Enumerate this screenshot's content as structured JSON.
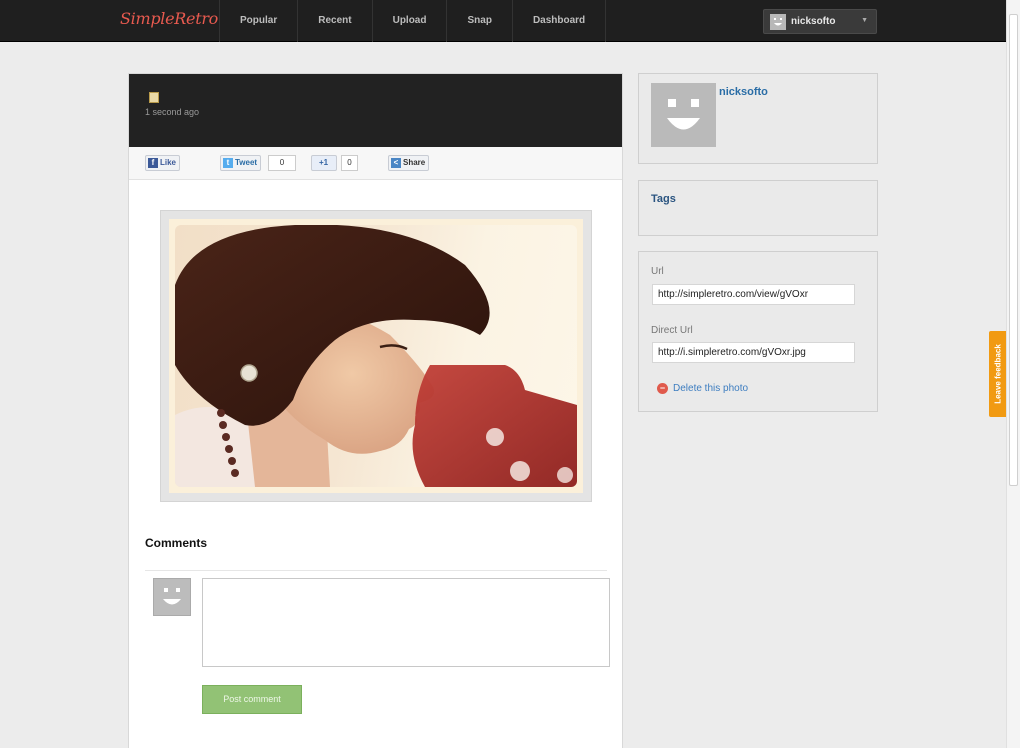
{
  "header": {
    "logo": "SimpleRetro",
    "nav": [
      "Popular",
      "Recent",
      "Upload",
      "Snap",
      "Dashboard"
    ],
    "user": "nicksofto"
  },
  "photo": {
    "timestamp": "1 second ago"
  },
  "share": {
    "like_label": "Like",
    "tweet_label": "Tweet",
    "tweet_count": "0",
    "plusone_label": "+1",
    "plusone_count": "0",
    "share_label": "Share"
  },
  "comments": {
    "title": "Comments",
    "placeholder": "",
    "post_label": "Post comment"
  },
  "sidebar": {
    "username": "nicksofto",
    "tags_title": "Tags",
    "url_label": "Url",
    "url_value": "http://simpleretro.com/view/gVOxr",
    "direct_url_label": "Direct Url",
    "direct_url_value": "http://i.simpleretro.com/gVOxr.jpg",
    "delete_label": "Delete this photo"
  },
  "feedback_label": "Leave feedback",
  "colors": {
    "topbar": "#1f1f1f",
    "link": "#2a6da6",
    "post_button": "#92c275",
    "feedback_tab": "#f19a12",
    "delete_icon": "#e05a4c"
  }
}
